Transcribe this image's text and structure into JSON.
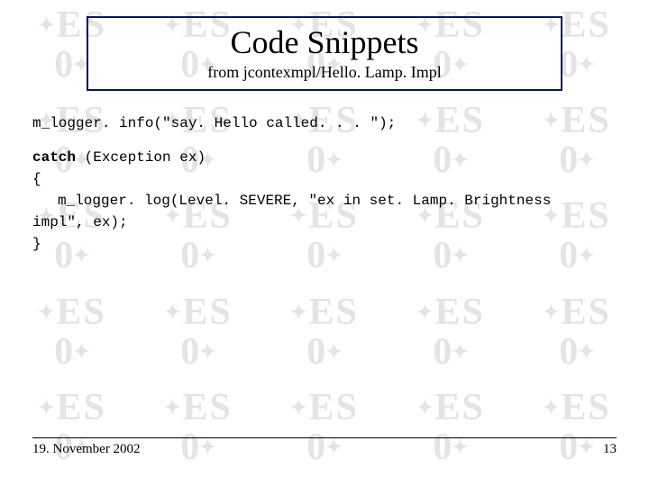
{
  "watermark": {
    "line1": "ES",
    "line2": "0"
  },
  "title": {
    "main": "Code Snippets",
    "sub": "from jcontexmpl/Hello. Lamp. Impl"
  },
  "code": {
    "line1": "m_logger. info(\"say. Hello called. . . \");",
    "catch_kw": "catch",
    "catch_rest": " (Exception ex)",
    "open_brace": "{",
    "body1": "m_logger. log(Level. SEVERE, \"ex in set. Lamp. Brightness",
    "body2": "impl\", ex);",
    "close_brace": "}"
  },
  "footer": {
    "date": "19. November 2002",
    "page": "13"
  }
}
